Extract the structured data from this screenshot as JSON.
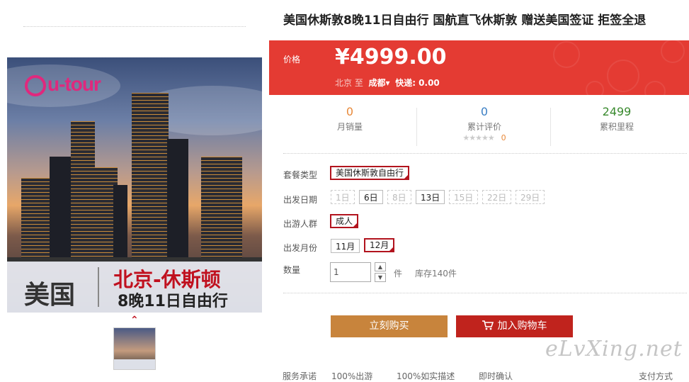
{
  "product": {
    "title": "美国休斯敦8晚11日自由行 国航直飞休斯敦 赠送美国签证 拒签全退"
  },
  "gallery": {
    "logo_text": "u-tour",
    "banner_left": "美国",
    "banner_right_line1": "北京-休斯顿",
    "banner_right_line2": "8晚11日自由行",
    "prev_glyph": "⌃"
  },
  "price": {
    "label": "价格",
    "value": "¥4999.00",
    "from": "北京",
    "to_word": "至",
    "destination": "成都",
    "dropdown_glyph": "▾",
    "shipping": "快递: 0.00"
  },
  "stats": {
    "monthly_sales": {
      "value": "0",
      "label": "月销量"
    },
    "reviews": {
      "value": "0",
      "label": "累计评价",
      "stars": "★★★★★",
      "score": "0"
    },
    "mileage": {
      "value": "2499",
      "label": "累积里程"
    }
  },
  "colors": {
    "price_band": "#e43b33",
    "selected_border": "#b2141e",
    "buy_button": "#c8843c",
    "cart_button": "#c0231d",
    "monthly_sales": "#e8893a",
    "reviews": "#3b7fc4",
    "mileage": "#3a8a2f"
  },
  "options": {
    "package": {
      "label": "套餐类型",
      "items": [
        {
          "text": "美国休斯敦自由行",
          "selected": true
        }
      ]
    },
    "dates": {
      "label": "出发日期",
      "items": [
        {
          "text": "1日",
          "state": "disabled"
        },
        {
          "text": "6日",
          "state": "available"
        },
        {
          "text": "8日",
          "state": "disabled"
        },
        {
          "text": "13日",
          "state": "available"
        },
        {
          "text": "15日",
          "state": "disabled"
        },
        {
          "text": "22日",
          "state": "disabled"
        },
        {
          "text": "29日",
          "state": "disabled"
        }
      ]
    },
    "traveler": {
      "label": "出游人群",
      "items": [
        {
          "text": "成人",
          "selected": true
        }
      ]
    },
    "month": {
      "label": "出发月份",
      "items": [
        {
          "text": "11月",
          "selected": false
        },
        {
          "text": "12月",
          "selected": true
        }
      ]
    },
    "quantity": {
      "label": "数量",
      "value": "1",
      "unit": "件",
      "stock": "库存140件",
      "up": "▲",
      "down": "▼"
    }
  },
  "actions": {
    "buy_now": "立刻购买",
    "add_to_cart": "加入购物车",
    "cart_icon": "cart-icon"
  },
  "watermark": "eLvXing.net",
  "footer_partial": {
    "service_label": "服务承诺",
    "item1": "100%出游",
    "item2": "100%如实描述",
    "item3": "即时确认",
    "payment": "支付方式"
  }
}
